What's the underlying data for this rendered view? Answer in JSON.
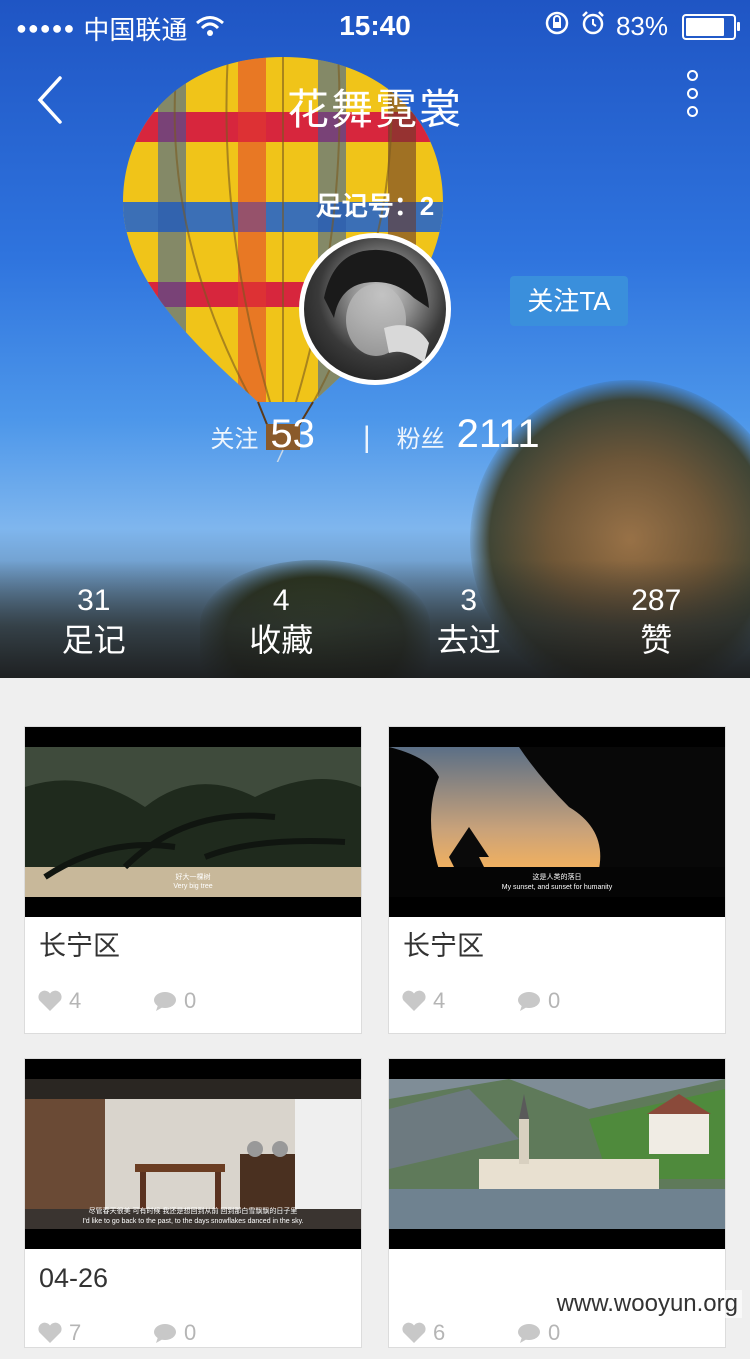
{
  "status_bar": {
    "signal": "●●●●●",
    "carrier": "中国联通",
    "time": "15:40",
    "battery": "83%",
    "icons": [
      "signal-dots-icon",
      "wifi-icon",
      "rotation-lock-icon",
      "alarm-icon",
      "battery-icon"
    ]
  },
  "header": {
    "title": "花舞霓裳",
    "id_text": "足记号：2",
    "follow_button": "关注TA"
  },
  "counts": {
    "following_label": "关注",
    "following_value": "53",
    "separator": "|",
    "fans_label": "粉丝",
    "fans_value": "2111"
  },
  "stats": [
    {
      "num": "31",
      "label": "足记"
    },
    {
      "num": "4",
      "label": "收藏"
    },
    {
      "num": "3",
      "label": "去过"
    },
    {
      "num": "287",
      "label": "赞"
    }
  ],
  "cards": [
    {
      "location": "长宁区",
      "likes": "4",
      "comments": "0",
      "subtitle_cn": "好大一棵树",
      "subtitle_en": "Very big tree",
      "scene": "tree"
    },
    {
      "location": "长宁区",
      "likes": "4",
      "comments": "0",
      "subtitle_cn": "这是人类的落日",
      "subtitle_en": "My sunset, and sunset for humanity",
      "scene": "sunset"
    },
    {
      "location": "04-26",
      "likes": "7",
      "comments": "0",
      "subtitle_cn": "尽管春天很美 可有时候 我还是想回到从前 回到那白雪飘飘的日子里",
      "subtitle_en": "I'd like to go back to the past, to the days snowflakes danced in the sky.",
      "scene": "cafe"
    },
    {
      "location": "",
      "likes": "6",
      "comments": "0",
      "subtitle_cn": "",
      "subtitle_en": "",
      "scene": "lake"
    }
  ],
  "watermark": "www.wooyun.org",
  "colors": {
    "accent": "#3a8fdc",
    "meta_gray": "#b5b5b5"
  }
}
